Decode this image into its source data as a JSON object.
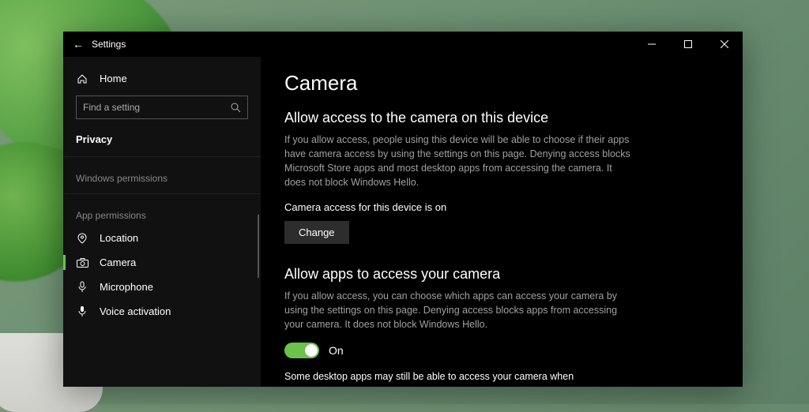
{
  "titlebar": {
    "title": "Settings"
  },
  "sidebar": {
    "home": "Home",
    "search_placeholder": "Find a setting",
    "privacy": "Privacy",
    "section1": "Windows permissions",
    "section2": "App permissions",
    "items": [
      {
        "label": "Location"
      },
      {
        "label": "Camera"
      },
      {
        "label": "Microphone"
      },
      {
        "label": "Voice activation"
      }
    ]
  },
  "main": {
    "page_title": "Camera",
    "section1_heading": "Allow access to the camera on this device",
    "section1_body": "If you allow access, people using this device will be able to choose if their apps have camera access by using the settings on this page. Denying access blocks Microsoft Store apps and most desktop apps from accessing the camera. It does not block Windows Hello.",
    "status_line": "Camera access for this device is on",
    "change_button": "Change",
    "section2_heading": "Allow apps to access your camera",
    "section2_body": "If you allow access, you can choose which apps can access your camera by using the settings on this page. Denying access blocks apps from accessing your camera. It does not block Windows Hello.",
    "toggle_label": "On",
    "note": "Some desktop apps may still be able to access your camera when"
  }
}
